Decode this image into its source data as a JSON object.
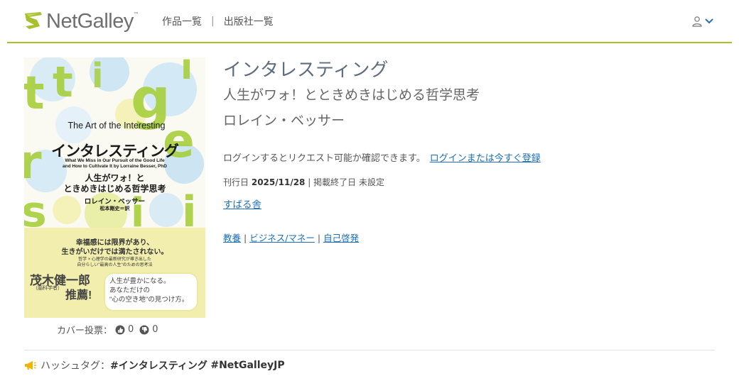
{
  "header": {
    "logo_text": "NetGalley",
    "logo_tm": "™",
    "nav": [
      {
        "label": "作品一覧"
      },
      {
        "label": "出版社一覧"
      }
    ],
    "nav_separator": "|",
    "account_icon": "user-icon",
    "account_chevron": "chevron-down-icon"
  },
  "cover": {
    "title_en": "The Art of the Interesting",
    "title_jp": "インタレスティング",
    "subtitle_en_1": "What We Miss in Our Pursuit of the Good Life",
    "subtitle_en_2": "and How to Cultivate It  by Lorraine Besser, PhD",
    "subtitle_jp_1": "人生がワォ！と",
    "subtitle_jp_2": "ときめきはじめる哲学思考",
    "author": "ロレイン・ベッサー",
    "translator": "松本剛史＝訳",
    "copy_1": "幸福感には限界があり、",
    "copy_2": "生きがいだけでは満たされない。",
    "copy_3": "哲学 × 心理学の最新研究が導き出した",
    "copy_4": "自分らしい\"最高の人生\"のための思考法",
    "recommender_name": "茂木健一郎",
    "recommender_role": "（脳科学者）",
    "recommend_word": "推薦!",
    "bubble_1": "人生が豊かになる。",
    "bubble_2": "あなただけの",
    "bubble_3": "\"心の空き地\"の見つけ方。"
  },
  "votes": {
    "label": "カバー投票：",
    "up_icon": "thumbs-up-icon",
    "up_count": "0",
    "down_icon": "thumbs-down-icon",
    "down_count": "0"
  },
  "book": {
    "title": "インタレスティング",
    "subtitle": "人生がワォ！とときめきはじめる哲学思考",
    "author": "ロレイン・ベッサー",
    "login_prompt": "ログインするとリクエスト可能か確認できます。",
    "login_link": "ログインまたは今すぐ登録",
    "pub_date_label": "刊行日",
    "pub_date": "2025/11/28",
    "pub_sep": "|",
    "end_label": "掲載終了日",
    "end_value": "未設定",
    "publisher": "すばる舎",
    "categories": [
      "教養",
      "ビジネス/マネー",
      "自己啓発"
    ],
    "category_sep": "|"
  },
  "hashtags": {
    "icon": "megaphone-icon",
    "label": "ハッシュタグ：",
    "tag_1": "#インタレスティング",
    "tag_2": "#NetGalleyJP"
  },
  "colors": {
    "brand_green": "#a8bf2e",
    "link_blue": "#1b6fb6",
    "title_gray": "#5e6e7e"
  }
}
